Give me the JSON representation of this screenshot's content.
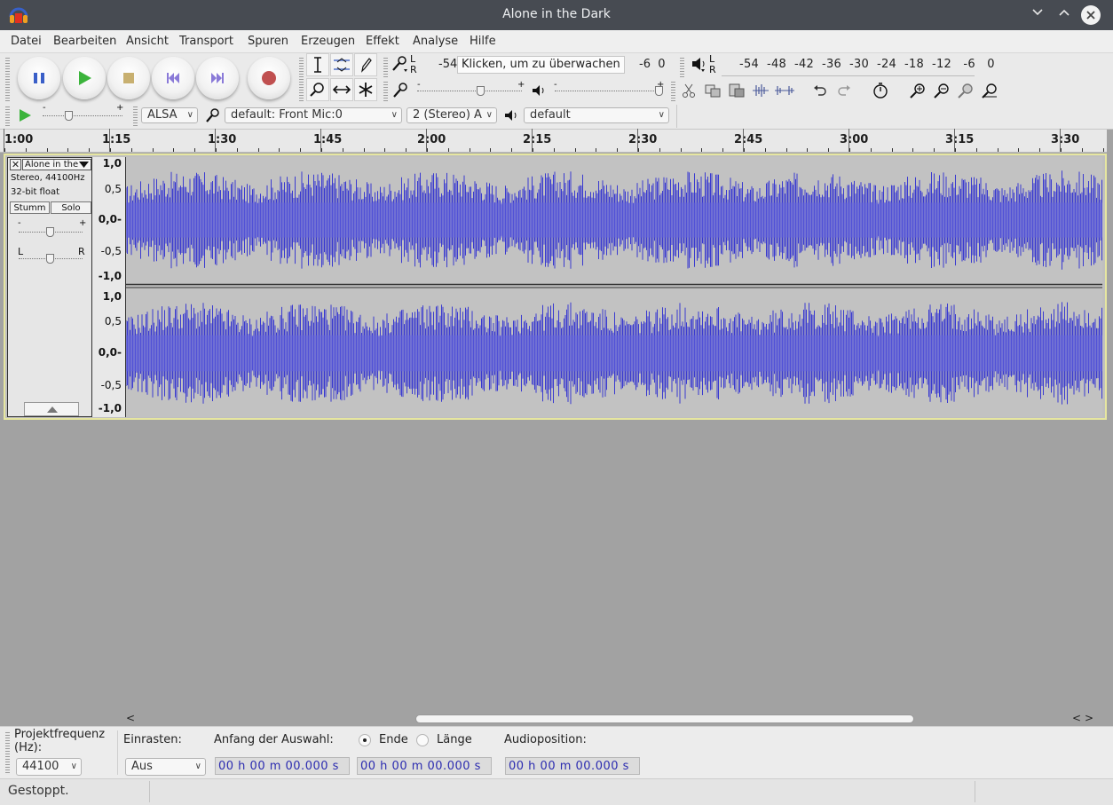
{
  "window": {
    "title": "Alone in the Dark"
  },
  "menu": [
    {
      "label": "Datei"
    },
    {
      "label": "Bearbeiten"
    },
    {
      "label": "Ansicht"
    },
    {
      "label": "Transport"
    },
    {
      "label": "Spuren"
    },
    {
      "label": "Erzeugen"
    },
    {
      "label": "Effekt"
    },
    {
      "label": "Analyse"
    },
    {
      "label": "Hilfe"
    }
  ],
  "recording_meter": {
    "scale": "-54",
    "hint": "Klicken, um zu überwachen",
    "tail": "-6  0",
    "channel_l": "L",
    "channel_r": "R"
  },
  "playback_meter": {
    "scale": "-54  -48  -42  -36  -30  -24  -18  -12   -6   0",
    "channel_l": "L",
    "channel_r": "R"
  },
  "device_toolbar": {
    "host": "ALSA",
    "recording_device": "default: Front Mic:0",
    "channels": "2 (Stereo) A",
    "playback_device": "default"
  },
  "timeline": {
    "ticks": [
      "1:00",
      "1:15",
      "1:30",
      "1:45",
      "2:00",
      "2:15",
      "2:30",
      "2:45",
      "3:00",
      "3:15",
      "3:30"
    ]
  },
  "track": {
    "name": "Alone in the",
    "info_format": "Stereo, 44100Hz",
    "info_depth": "32-bit float",
    "mute_label": "Stumm",
    "solo_label": "Solo",
    "gain_minus": "-",
    "gain_plus": "+",
    "pan_left": "L",
    "pan_right": "R",
    "waveform_color": "#3a3ad0",
    "channel_scale": [
      "1,0",
      "0,5",
      "0,0-",
      "-0,5",
      "-1,0"
    ]
  },
  "selection_bar": {
    "project_rate_label": "Projektfrequenz (Hz):",
    "project_rate_value": "44100",
    "snap_label": "Einrasten:",
    "snap_value": "Aus",
    "selection_start_label": "Anfang der Auswahl:",
    "radio_end": "Ende",
    "radio_length": "Länge",
    "audio_position_label": "Audioposition:",
    "selection_start": "00 h 00 m 00.000 s",
    "selection_end": "00 h 00 m 00.000 s",
    "audio_position": "00 h 00 m 00.000 s"
  },
  "status": {
    "text": "Gestoppt."
  }
}
